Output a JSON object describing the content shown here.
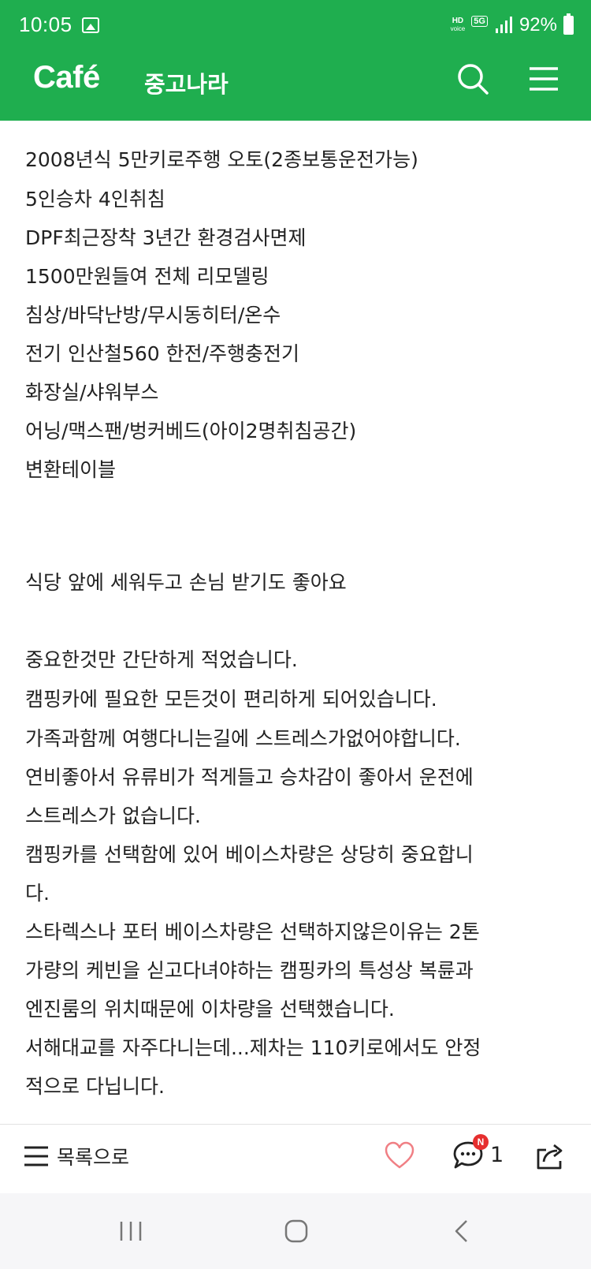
{
  "status_bar": {
    "time": "10:05",
    "network_label_top": "HD",
    "network_label_bottom": "voice",
    "network_type": "5G",
    "battery_percent": "92%"
  },
  "header": {
    "logo": "Café",
    "cafe_name": "중고나라",
    "accent_color": "#1fae4f"
  },
  "article": {
    "lines": [
      "2008년식 5만키로주행 오토(2종보통운전가능)",
      "5인승차 4인취침",
      "DPF최근장착 3년간 환경검사면제",
      "1500만원들여 전체 리모델링",
      "침상/바닥난방/무시동히터/온수",
      "전기 인산철560 한전/주행충전기",
      "화장실/샤워부스",
      "어닝/맥스팬/벙커베드(아이2명취침공간)",
      "변환테이블",
      "식당 앞에 세워두고 손님 받기도 좋아요",
      "중요한것만 간단하게 적었습니다.",
      "캠핑카에 필요한 모든것이 편리하게 되어있습니다.",
      "가족과함께 여행다니는길에 스트레스가없어야합니다.",
      "연비좋아서 유류비가 적게들고 승차감이 좋아서 운전에",
      "스트레스가 없습니다.",
      "캠핑카를 선택함에 있어 베이스차량은 상당히 중요합니",
      "다.",
      "스타렉스나 포터 베이스차량은 선택하지않은이유는 2톤",
      "가량의 케빈을 싣고다녀야하는 캠핑카의 특성상 복륜과",
      "엔진룸의 위치때문에 이차량을 선택했습니다.",
      "서해대교를 자주다니는데...제차는 110키로에서도 안정",
      "적으로 다닙니다."
    ]
  },
  "bottom_bar": {
    "list_label": "목록으로",
    "comment_badge": "N",
    "comment_count": "1"
  },
  "icons": {
    "search": "search-icon",
    "menu": "hamburger-menu-icon",
    "list": "list-icon",
    "like": "heart-icon",
    "comment": "comment-icon",
    "share": "share-icon"
  }
}
